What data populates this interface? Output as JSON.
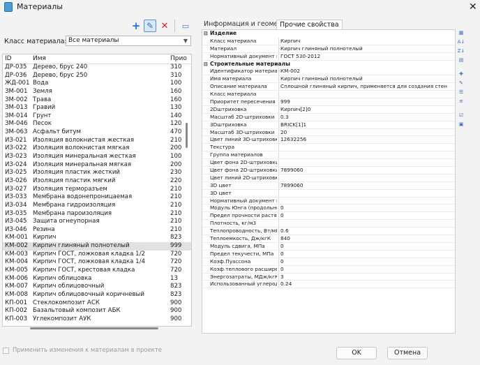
{
  "window": {
    "title": "Материалы",
    "close": "✕"
  },
  "toolbar": {
    "add": "+",
    "edit": "✎",
    "delete": "✕",
    "other": "▭"
  },
  "class_filter": {
    "label": "Класс материала:",
    "value": "Все материалы"
  },
  "list": {
    "headers": {
      "id": "ID",
      "name": "Имя",
      "prio": "Прио"
    },
    "selected_index": 28,
    "rows": [
      {
        "id": "ДР-035",
        "name": "Дерево, брус 240",
        "prio": "310"
      },
      {
        "id": "ДР-036",
        "name": "Дерево, брус 250",
        "prio": "310"
      },
      {
        "id": "ЖД-001",
        "name": "Вода",
        "prio": "100"
      },
      {
        "id": "ЗМ-001",
        "name": "Земля",
        "prio": "160"
      },
      {
        "id": "ЗМ-002",
        "name": "Трава",
        "prio": "160"
      },
      {
        "id": "ЗМ-013",
        "name": "Гравий",
        "prio": "130"
      },
      {
        "id": "ЗМ-014",
        "name": "Грунт",
        "prio": "140"
      },
      {
        "id": "ЗМ-046",
        "name": "Песок",
        "prio": "120"
      },
      {
        "id": "ЗМ-063",
        "name": "Асфальт битум",
        "prio": "470"
      },
      {
        "id": "ИЗ-021",
        "name": "Изоляция волокнистая жесткая",
        "prio": "210"
      },
      {
        "id": "ИЗ-022",
        "name": "Изоляция волокнистая мягкая",
        "prio": "200"
      },
      {
        "id": "ИЗ-023",
        "name": "Изоляция минеральная жесткая",
        "prio": "100"
      },
      {
        "id": "ИЗ-024",
        "name": "Изоляция минеральная мягкая",
        "prio": "200"
      },
      {
        "id": "ИЗ-025",
        "name": "Изоляция пластик жесткий",
        "prio": "230"
      },
      {
        "id": "ИЗ-026",
        "name": "Изоляция пластик мягкий",
        "prio": "220"
      },
      {
        "id": "ИЗ-027",
        "name": "Изоляция терморазъем",
        "prio": "210"
      },
      {
        "id": "ИЗ-033",
        "name": "Мембрана водонепроницаемая",
        "prio": "210"
      },
      {
        "id": "ИЗ-034",
        "name": "Мембрана гидроизоляция",
        "prio": "210"
      },
      {
        "id": "ИЗ-035",
        "name": "Мембрана пароизоляция",
        "prio": "210"
      },
      {
        "id": "ИЗ-045",
        "name": "Защита огнеупорная",
        "prio": "210"
      },
      {
        "id": "ИЗ-046",
        "name": "Резина",
        "prio": "210"
      },
      {
        "id": "КМ-001",
        "name": "Кирпич",
        "prio": "823"
      },
      {
        "id": "КМ-002",
        "name": "Кирпич глиняный полнотелый",
        "prio": "999"
      },
      {
        "id": "КМ-003",
        "name": "Кирпич ГОСТ, ложковая кладка 1/2",
        "prio": "720"
      },
      {
        "id": "КМ-004",
        "name": "Кирпич ГОСТ, ложковая кладка 1/4",
        "prio": "720"
      },
      {
        "id": "КМ-005",
        "name": "Кирпич ГОСТ, крестовая кладка",
        "prio": "720"
      },
      {
        "id": "КМ-006",
        "name": "Кирпич облицовка",
        "prio": "13"
      },
      {
        "id": "КМ-007",
        "name": "Кирпич облицовочный",
        "prio": "823"
      },
      {
        "id": "КМ-008",
        "name": "Кирпич облицовочный коричневый",
        "prio": "823"
      },
      {
        "id": "КП-001",
        "name": "Стеклокомпозит АСК",
        "prio": "900"
      },
      {
        "id": "КП-002",
        "name": "Базальтовый композит АБК",
        "prio": "900"
      },
      {
        "id": "КП-003",
        "name": "Углекомпозит АУК",
        "prio": "900"
      }
    ]
  },
  "tabs": {
    "info": "Информация и геометрия",
    "props": "Прочие свойства"
  },
  "properties": [
    {
      "group": "Изделие"
    },
    {
      "name": "Класс материала",
      "value": "Кирпич"
    },
    {
      "name": "Материал",
      "value": "Кирпич глиняный полнотелый"
    },
    {
      "name": "Нормативный документ на...",
      "value": "ГОСТ 530-2012"
    },
    {
      "group": "Строительные материалы"
    },
    {
      "name": "Идентификатор материала",
      "value": "КМ-002"
    },
    {
      "name": "Имя материала",
      "value": "Кирпич глиняный полнотелый"
    },
    {
      "name": "Описание материала",
      "value": "Сплошной глиняный кирпич, применяется для создания стен"
    },
    {
      "name": "Класс материала",
      "value": ""
    },
    {
      "name": "Приоритет пересечения",
      "value": "999"
    },
    {
      "name": "2Dштриховка",
      "value": "Кирпич[2]0"
    },
    {
      "name": "Масштаб 2D-штриховки",
      "value": "0.3"
    },
    {
      "name": "3Dштриховка",
      "value": "BRICK[1]1"
    },
    {
      "name": "Масштаб 3D-штриховки",
      "value": "20"
    },
    {
      "name": "Цвет линий 3D-штриховки",
      "value": "12632256"
    },
    {
      "name": "Текстура",
      "value": ""
    },
    {
      "name": "Группа материалов",
      "value": ""
    },
    {
      "name": "Цвет фона 2D-штриховки",
      "value": ""
    },
    {
      "name": "Цвет фона 2D-штриховки",
      "value": "7899060"
    },
    {
      "name": "Цвет линий 2D-штриховки",
      "value": ""
    },
    {
      "name": "3D цвет",
      "value": "7899060"
    },
    {
      "name": "3D цвет",
      "value": ""
    },
    {
      "name": "Нормативный документ на...",
      "value": ""
    },
    {
      "name": "Модуль Юнга (продольной ...",
      "value": "0"
    },
    {
      "name": "Предел прочности растяж...",
      "value": "0"
    },
    {
      "name": "Плотность, кг/м3",
      "value": ""
    },
    {
      "name": "Теплопроводность, Вт/мК",
      "value": "0.6"
    },
    {
      "name": "Теплоемкость, Дж/кгК",
      "value": "840"
    },
    {
      "name": "Модуль сдвига, МПа",
      "value": "0"
    },
    {
      "name": "Предел текучести, МПа",
      "value": "0"
    },
    {
      "name": "Коэф.Пуассона",
      "value": "0"
    },
    {
      "name": "Коэф.теплового расширен...",
      "value": "0"
    },
    {
      "name": "Энергозатраты, МДж/кгК",
      "value": "3"
    },
    {
      "name": "Использованный углерод,...",
      "value": "0.24"
    }
  ],
  "apply_label": "Применить изменения к материалам в проекте",
  "buttons": {
    "ok": "OK",
    "cancel": "Отмена"
  }
}
